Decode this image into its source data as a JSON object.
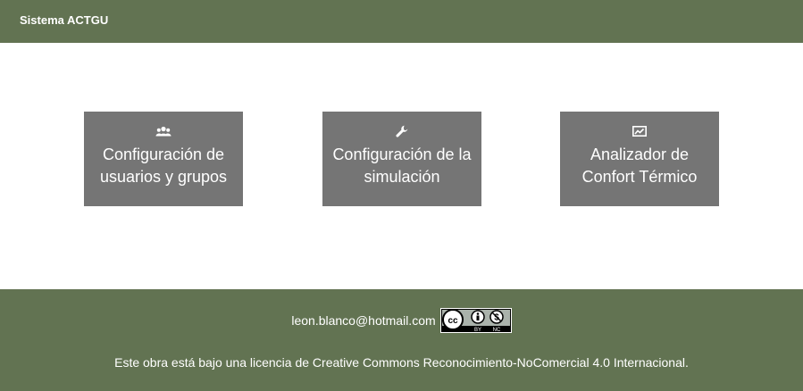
{
  "header": {
    "brand": "Sistema ACTGU"
  },
  "tiles": [
    {
      "icon": "users-icon",
      "label": "Configuración de usuarios y grupos"
    },
    {
      "icon": "wrench-icon",
      "label": "Configuración de la simulación"
    },
    {
      "icon": "chart-icon",
      "label": "Analizador de Confort Térmico"
    }
  ],
  "footer": {
    "email": "leon.blanco@hotmail.com",
    "badge": {
      "icon": "cc-by-nc-badge-icon",
      "text_by": "BY",
      "text_nc": "NC"
    },
    "license": "Este obra está bajo una licencia de Creative Commons Reconocimiento-NoComercial 4.0 Internacional."
  },
  "colors": {
    "header_bg": "#627352",
    "footer_bg": "#627352",
    "tile_bg": "#757575",
    "page_bg": "#ffffff"
  }
}
